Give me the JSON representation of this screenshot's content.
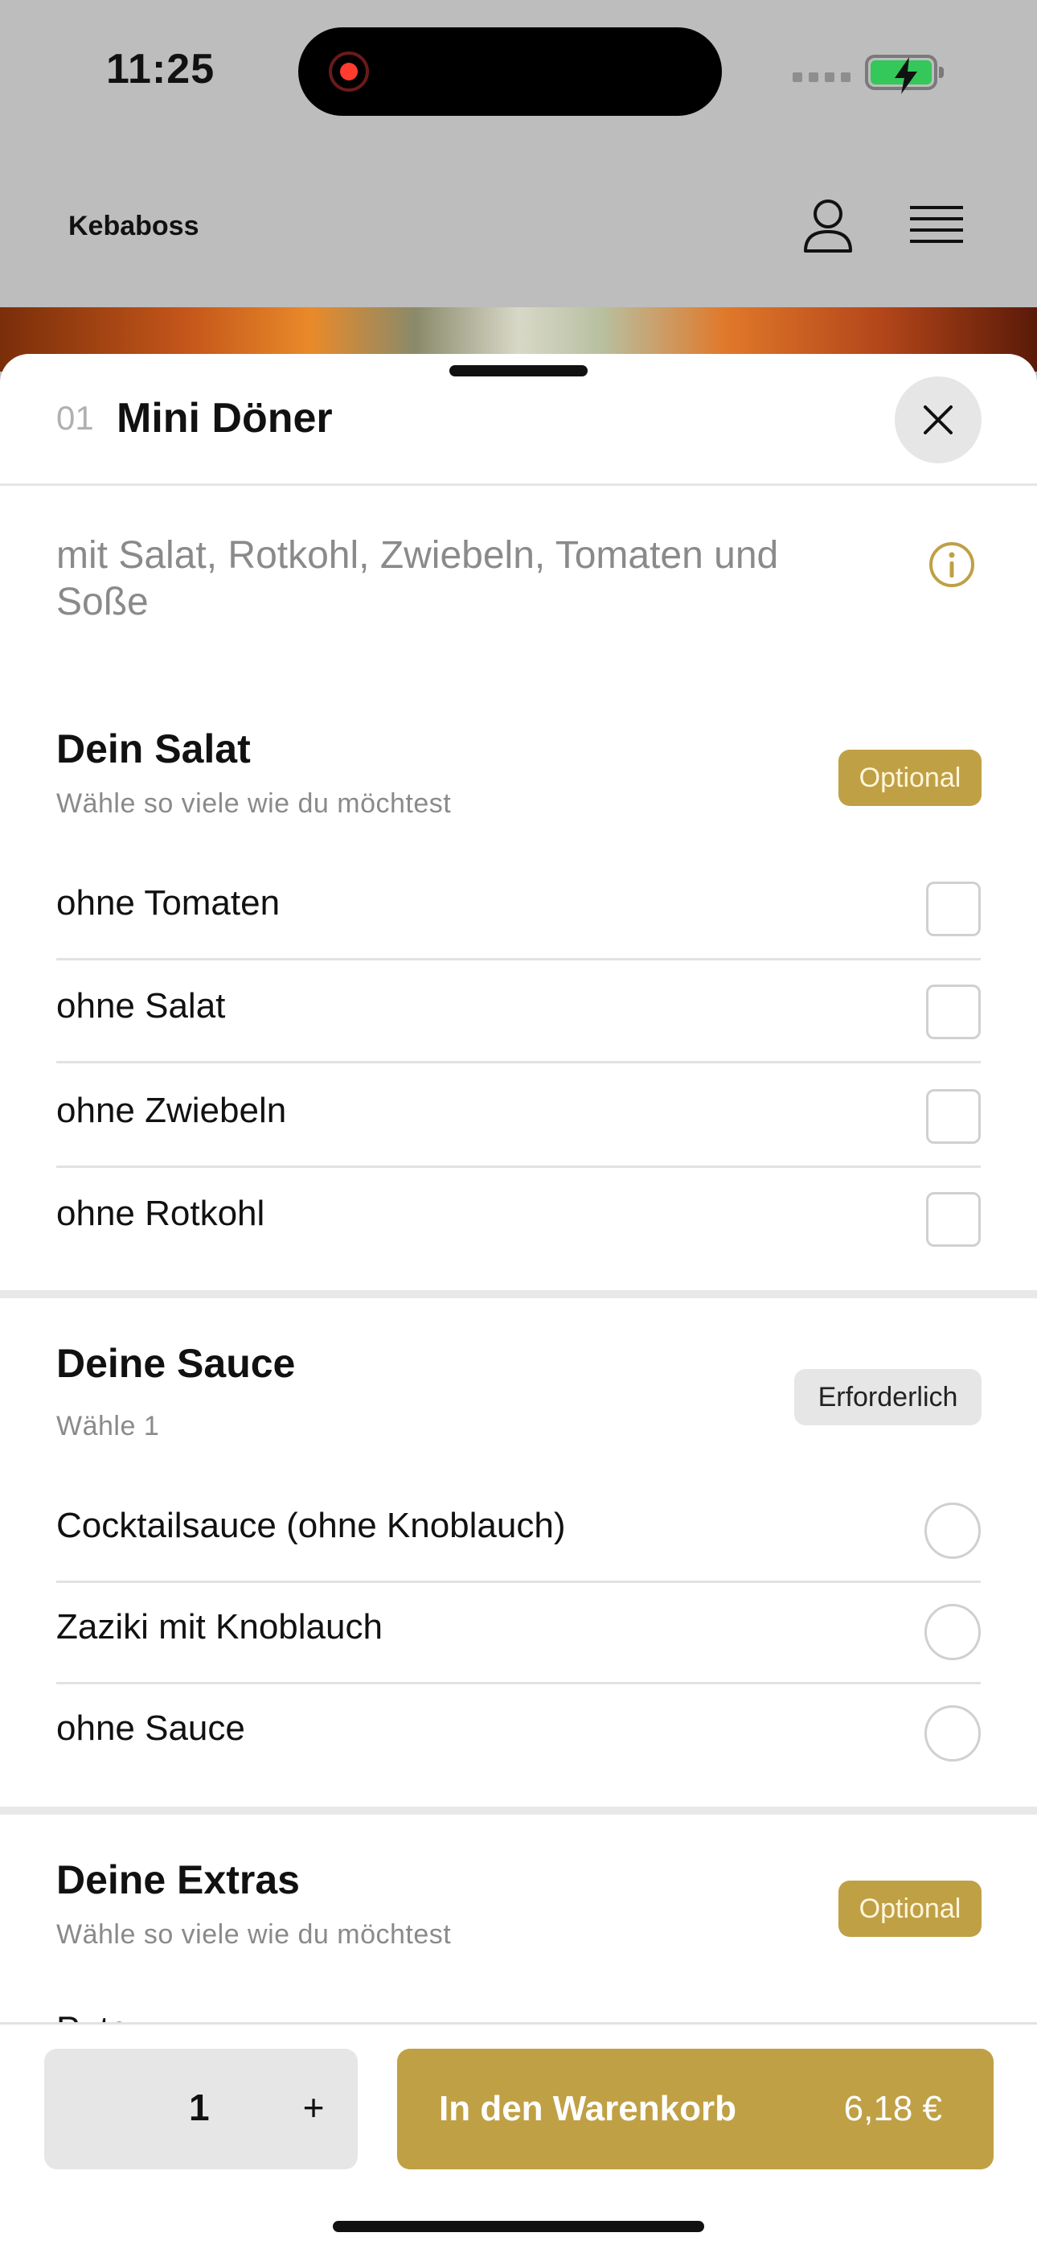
{
  "status_bar": {
    "time": "11:25"
  },
  "header": {
    "brand": "Kebaboss"
  },
  "item": {
    "number": "01",
    "title": "Mini Döner",
    "description": "mit Salat, Rotkohl, Zwiebeln, Tomaten und Soße"
  },
  "sections": [
    {
      "title": "Dein Salat",
      "subtitle": "Wähle so viele wie du möchtest",
      "badge": "Optional",
      "type": "checkbox",
      "options": [
        "ohne Tomaten",
        "ohne Salat",
        "ohne Zwiebeln",
        "ohne Rotkohl"
      ]
    },
    {
      "title": "Deine Sauce",
      "subtitle": "Wähle 1",
      "badge": "Erforderlich",
      "type": "radio",
      "options": [
        "Cocktailsauce (ohne Knoblauch)",
        "Zaziki mit Knoblauch",
        "ohne Sauce"
      ]
    },
    {
      "title": "Deine Extras",
      "subtitle": "Wähle so viele wie du möchtest",
      "badge": "Optional",
      "type": "checkbox",
      "options": [
        "Pute"
      ]
    }
  ],
  "bottom_bar": {
    "quantity": "1",
    "plus": "+",
    "cart_label": "In den Warenkorb",
    "price": "6,18 €"
  },
  "colors": {
    "accent": "#c0a045",
    "required_badge": "#e6e6e6",
    "backdrop": "#bdbdbd"
  },
  "icons": [
    "user-icon",
    "menu-icon",
    "close-icon",
    "info-icon",
    "battery-icon",
    "record-icon"
  ]
}
